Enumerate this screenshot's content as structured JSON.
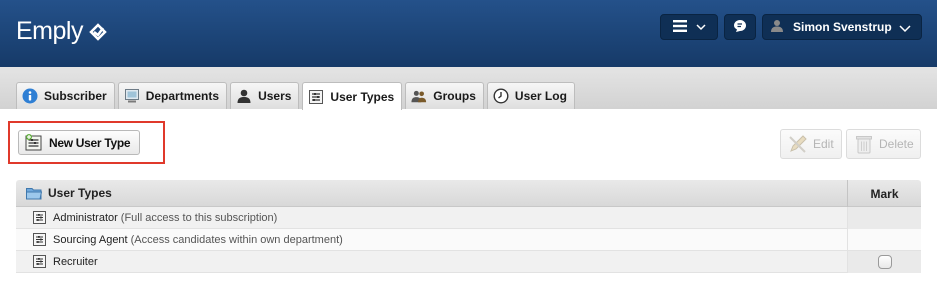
{
  "header": {
    "logo_text": "Emply",
    "logo_icon": "emply-logo-icon",
    "menu_icon": "hamburger-icon",
    "chat_icon": "chat-icon",
    "user_icon": "user-silhouette-icon",
    "user_name": "Simon Svenstrup"
  },
  "tabs": [
    {
      "label": "Subscriber",
      "icon": "info-icon",
      "active": false
    },
    {
      "label": "Departments",
      "icon": "computer-icon",
      "active": false
    },
    {
      "label": "Users",
      "icon": "user-icon",
      "active": false
    },
    {
      "label": "User Types",
      "icon": "list-icon",
      "active": true
    },
    {
      "label": "Groups",
      "icon": "group-icon",
      "active": false
    },
    {
      "label": "User Log",
      "icon": "clock-icon",
      "active": false
    }
  ],
  "toolbar": {
    "new_label": "New User Type",
    "edit_label": "Edit",
    "delete_label": "Delete"
  },
  "table": {
    "header_title": "User Types",
    "mark_header": "Mark",
    "rows": [
      {
        "name": "Administrator",
        "description": "(Full access to this subscription)",
        "has_checkbox": false
      },
      {
        "name": "Sourcing Agent",
        "description": "(Access candidates within own department)",
        "has_checkbox": false
      },
      {
        "name": "Recruiter",
        "description": "",
        "has_checkbox": true
      }
    ]
  },
  "colors": {
    "header_bg": "#1e4678",
    "highlight_border": "#e0392b"
  }
}
